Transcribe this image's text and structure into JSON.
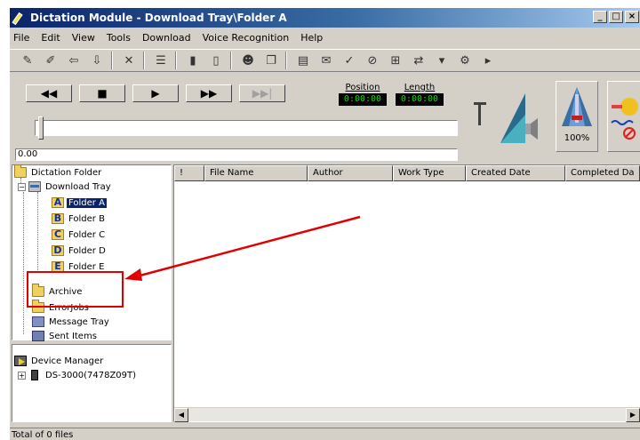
{
  "window": {
    "title": "Dictation Module - Download Tray\\Folder A",
    "controls": [
      "_",
      "□",
      "×"
    ]
  },
  "menu": [
    "File",
    "Edit",
    "View",
    "Tools",
    "Download",
    "Voice Recognition",
    "Help"
  ],
  "transport": {
    "rewind": "◀◀",
    "stop": "■",
    "play": "▶",
    "fast_forward": "▶▶",
    "skip_end": "▶▶|",
    "position_label": "Position",
    "position_value": "0:00:00",
    "length_label": "Length",
    "length_value": "0:00:00",
    "slider_value": "0.00",
    "speed_percent": "100%"
  },
  "tree": {
    "root": "Dictation Folder",
    "download_tray": "Download Tray",
    "folders": [
      {
        "letter": "A",
        "label": "Folder A"
      },
      {
        "letter": "B",
        "label": "Folder B"
      },
      {
        "letter": "C",
        "label": "Folder C"
      },
      {
        "letter": "D",
        "label": "Folder D"
      },
      {
        "letter": "E",
        "label": "Folder E"
      }
    ],
    "archive": "Archive",
    "error_jobs": "ErrorJobs",
    "message_tray": "Message Tray",
    "sent_items": "Sent Items"
  },
  "device_tree": {
    "root": "Device Manager",
    "device": "DS-3000(7478Z09T)"
  },
  "list": {
    "columns": [
      "!",
      "File Name",
      "Author",
      "Work Type",
      "Created Date",
      "Completed Da"
    ]
  },
  "status": {
    "text": "Total of 0 files"
  },
  "colors": {
    "titlebar_start": "#0a246a",
    "annotation_red": "#e00000",
    "lcd_text": "#00e000"
  }
}
